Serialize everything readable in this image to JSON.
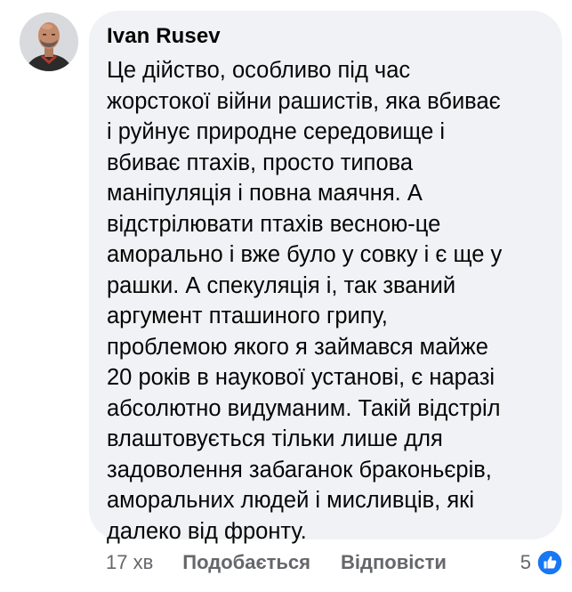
{
  "comment": {
    "author": "Ivan Rusev",
    "text": "Це дійство, особливо під час\nжорстокої війни рашистів, яка вбиває\nі руйнує природне середовище і\nвбиває птахів, просто типова\nманіпуляція і повна маячня. А\nвідстрілювати птахів весною-це\nаморально і вже було у совку і є ще у\nрашки. А спекуляція і, так званий\nаргумент пташиного грипу,\nпроблемою якого я займався майже\n20 років в наукової установі, є наразі\nабсолютно видуманим. Такій відстріл\nвлаштовується тільки лише для\nзадоволення забаганок браконьєрів,\nаморальних людей і мисливців, які\nдалеко від фронту.",
    "timestamp": "17 хв",
    "like_label": "Подобається",
    "reply_label": "Відповісти",
    "reaction_count": "5",
    "reaction_icon": "like-icon"
  },
  "colors": {
    "bubble_bg": "#f0f2f5",
    "meta_text": "#65676b",
    "like_blue": "#1877f2"
  }
}
